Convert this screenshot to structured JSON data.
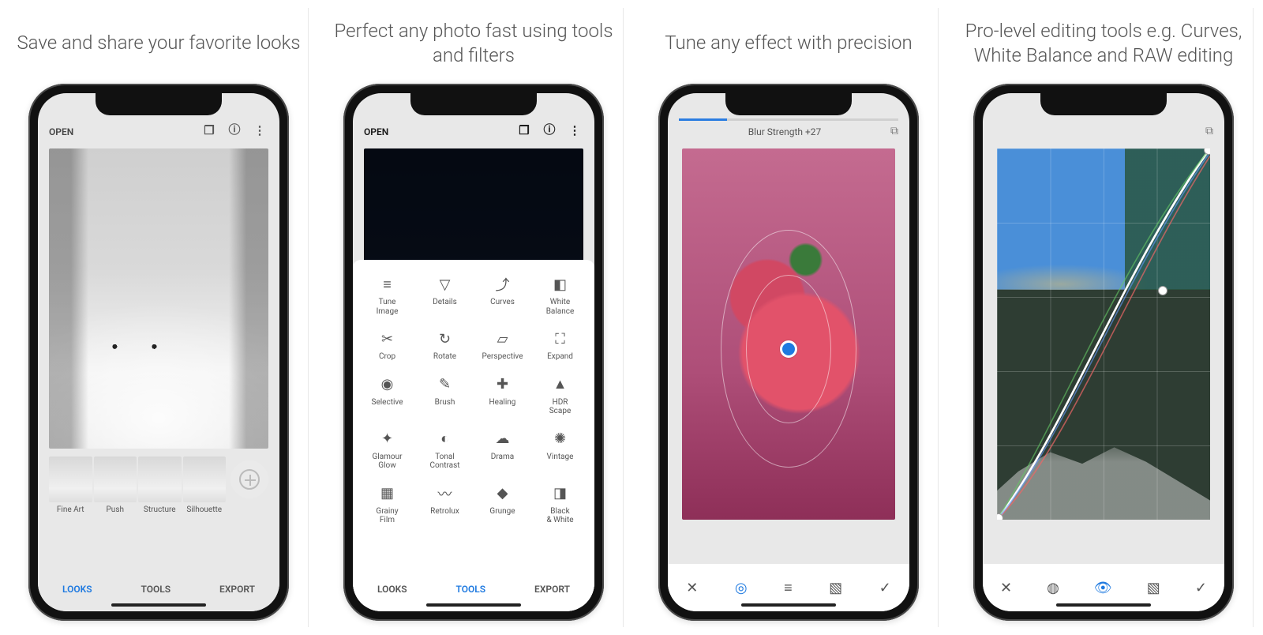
{
  "panels": [
    {
      "caption": "Save and share your favorite looks"
    },
    {
      "caption": "Perfect any photo fast using tools and filters"
    },
    {
      "caption": "Tune any effect with precision"
    },
    {
      "caption": "Pro-level editing tools e.g. Curves, White Balance and RAW editing"
    }
  ],
  "topbar": {
    "open": "OPEN"
  },
  "bottombar": {
    "looks": "LOOKS",
    "tools": "TOOLS",
    "export": "EXPORT"
  },
  "looks": [
    {
      "label": "Fine Art"
    },
    {
      "label": "Push"
    },
    {
      "label": "Structure"
    },
    {
      "label": "Silhouette"
    }
  ],
  "tools": [
    {
      "icon": "tune-image-icon",
      "glyph": "≡",
      "label": "Tune Image"
    },
    {
      "icon": "details-icon",
      "glyph": "▽",
      "label": "Details"
    },
    {
      "icon": "curves-icon",
      "glyph": "⤴",
      "label": "Curves"
    },
    {
      "icon": "white-balance-icon",
      "glyph": "◧",
      "label": "White Balance"
    },
    {
      "icon": "crop-icon",
      "glyph": "✂",
      "label": "Crop"
    },
    {
      "icon": "rotate-icon",
      "glyph": "↻",
      "label": "Rotate"
    },
    {
      "icon": "perspective-icon",
      "glyph": "▱",
      "label": "Perspective"
    },
    {
      "icon": "expand-icon",
      "glyph": "⛶",
      "label": "Expand"
    },
    {
      "icon": "selective-icon",
      "glyph": "◉",
      "label": "Selective"
    },
    {
      "icon": "brush-icon",
      "glyph": "✎",
      "label": "Brush"
    },
    {
      "icon": "healing-icon",
      "glyph": "✚",
      "label": "Healing"
    },
    {
      "icon": "hdr-scape-icon",
      "glyph": "▲",
      "label": "HDR Scape"
    },
    {
      "icon": "glamour-glow-icon",
      "glyph": "✦",
      "label": "Glamour Glow"
    },
    {
      "icon": "tonal-contrast-icon",
      "glyph": "◐",
      "label": "Tonal Contrast"
    },
    {
      "icon": "drama-icon",
      "glyph": "☁",
      "label": "Drama"
    },
    {
      "icon": "vintage-icon",
      "glyph": "✺",
      "label": "Vintage"
    },
    {
      "icon": "grainy-film-icon",
      "glyph": "▦",
      "label": "Grainy Film"
    },
    {
      "icon": "retrolux-icon",
      "glyph": "〰",
      "label": "Retrolux"
    },
    {
      "icon": "grunge-icon",
      "glyph": "◆",
      "label": "Grunge"
    },
    {
      "icon": "black-white-icon",
      "glyph": "◨",
      "label": "Black & White"
    }
  ],
  "tune": {
    "label": "Blur Strength +27"
  },
  "iconbar3": [
    {
      "name": "close-icon",
      "glyph": "✕",
      "active": false
    },
    {
      "name": "target-icon",
      "glyph": "◎",
      "active": true
    },
    {
      "name": "sliders-icon",
      "glyph": "≡",
      "active": false
    },
    {
      "name": "styles-icon",
      "glyph": "▧",
      "active": false
    },
    {
      "name": "check-icon",
      "glyph": "✓",
      "active": false
    }
  ],
  "iconbar4": [
    {
      "name": "close-icon",
      "glyph": "✕",
      "active": false
    },
    {
      "name": "luminance-icon",
      "glyph": "◍",
      "active": false
    },
    {
      "name": "eye-icon",
      "glyph": "👁",
      "active": true
    },
    {
      "name": "styles-icon",
      "glyph": "▧",
      "active": false
    },
    {
      "name": "check-icon",
      "glyph": "✓",
      "active": false
    }
  ]
}
